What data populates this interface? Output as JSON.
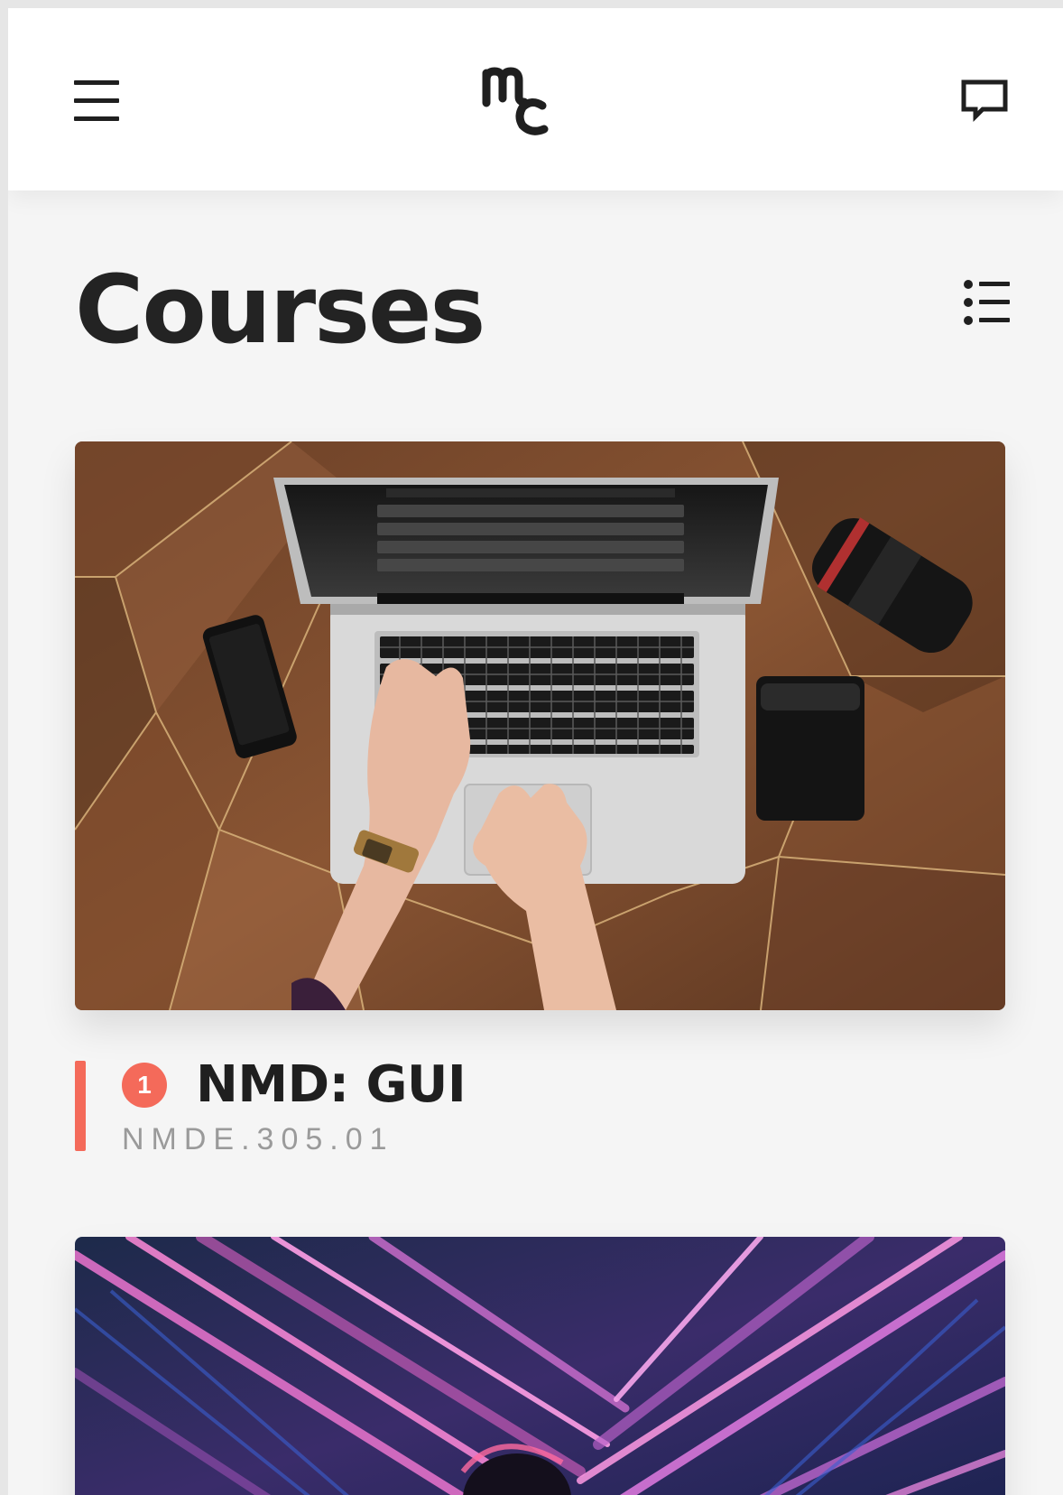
{
  "header": {
    "menu_icon": "hamburger-menu-icon",
    "logo_icon": "mc-logo",
    "chat_icon": "chat-bubble-icon"
  },
  "page": {
    "title": "Courses",
    "view_toggle_icon": "list-view-icon"
  },
  "courses": [
    {
      "number": "1",
      "title": "NMD: GUI",
      "code": "NMDE.305.01",
      "image": "laptop-on-wooden-desk-photo",
      "accent_color": "#f46a5a"
    },
    {
      "image": "neon-lights-photo"
    }
  ],
  "colors": {
    "accent": "#f46a5a",
    "text": "#232323",
    "muted": "#9a9a9a",
    "background": "#f5f5f5"
  }
}
